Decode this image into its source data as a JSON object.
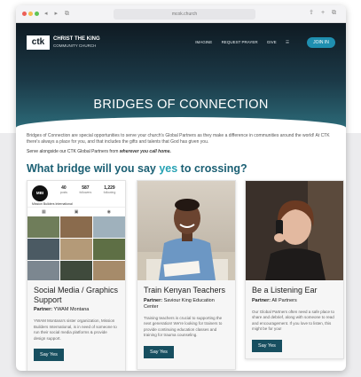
{
  "browser": {
    "url": "mcok.church",
    "nav_icons": "◂ ▸ ⧉",
    "right_icons": "⇪ + ⧉"
  },
  "hero": {
    "logo_mark": "ctk",
    "logo_name": "CHRIST THE KING",
    "logo_sub": "COMMUNITY CHURCH",
    "nav": [
      "IMAGINE",
      "REQUEST PRAYER",
      "GIVE",
      "☰"
    ],
    "join_label": "JOIN IN",
    "title": "BRIDGES OF CONNECTION"
  },
  "intro": {
    "paragraph": "Bridges of Connection are special opportunities to serve your church's Global Partners as they make a difference in communities around the world! At CTK there's always a place for you, and that includes the gifts and talents that God has given you.",
    "serve_prefix": "Serve alongside our CTK Global Partners from ",
    "serve_emph": "wherever you call home."
  },
  "question": {
    "before": "What bridge will you say ",
    "yes": "yes",
    "after": " to crossing?"
  },
  "cards": [
    {
      "title": "Social Media / Graphics Support",
      "partner_label": "Partner:",
      "partner": "YWAM Montana",
      "description": "YWAM Montana's sister organization, Mission Builders International, is in need of someone to run their social media platforms & provide design support.",
      "button": "Say Yes",
      "ig_avatar": "MBI",
      "ig_stats": [
        {
          "value": "40",
          "label": "posts"
        },
        {
          "value": "587",
          "label": "followers"
        },
        {
          "value": "1,229",
          "label": "following"
        }
      ],
      "ig_name": "Mission Builders International",
      "ig_icons": [
        "▦",
        "▣",
        "◉"
      ]
    },
    {
      "title": "Train Kenyan Teachers",
      "partner_label": "Partner:",
      "partner": "Saviour King Education Center",
      "description": "Training teachers is crucial to supporting the next generation! We're looking for trainers to provide continuing education classes and training for trauma counseling.",
      "button": "Say Yes"
    },
    {
      "title": "Be a Listening Ear",
      "partner_label": "Partner:",
      "partner": "All Partners",
      "description": "Our Global Partners often need a safe place to share and debrief, along with someone to read and encouragement. If you love to listen, this might be for you!",
      "button": "Say Yes"
    }
  ]
}
